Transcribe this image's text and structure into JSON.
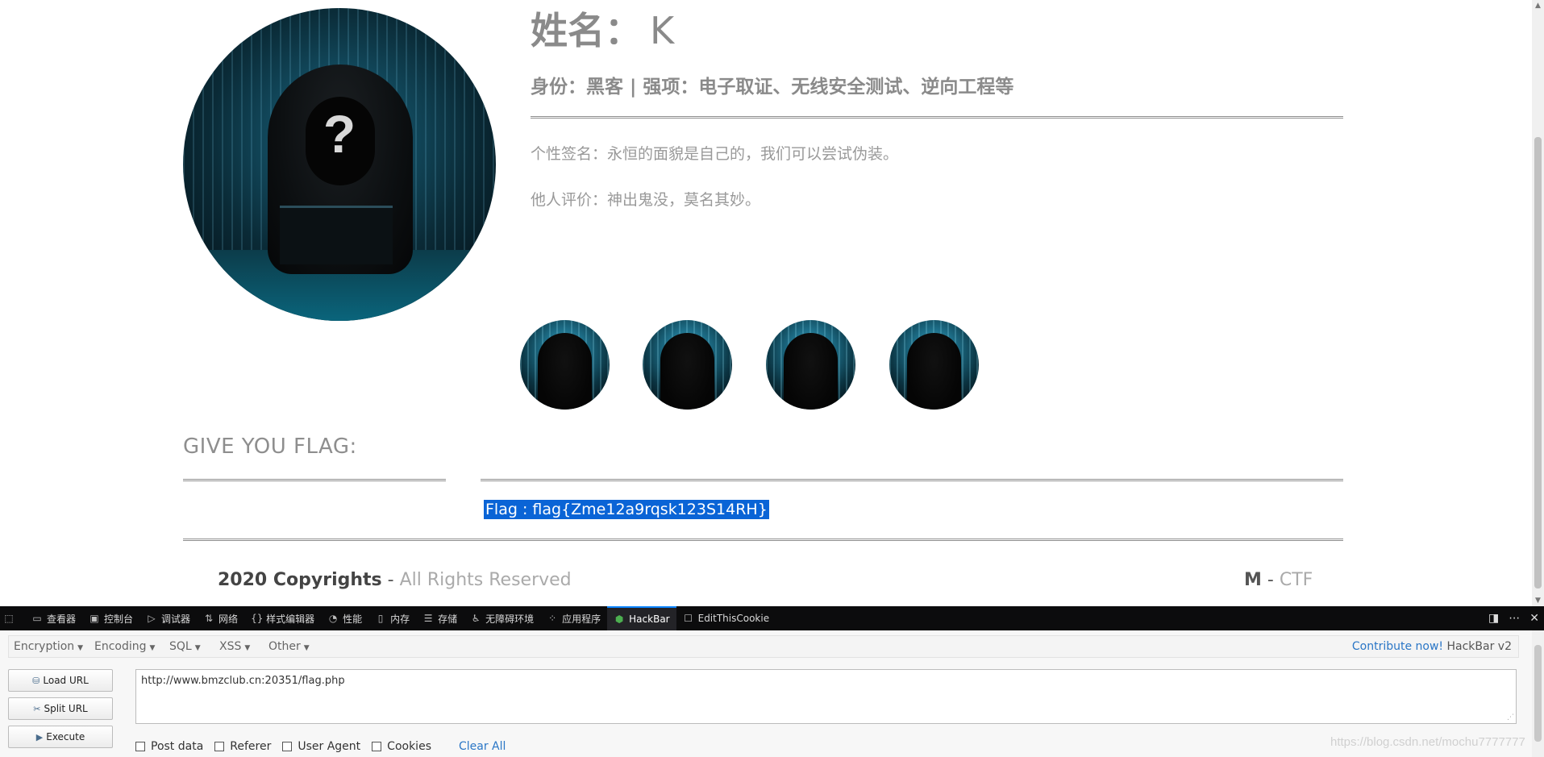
{
  "profile": {
    "name_label": "姓名：",
    "name_value": "K",
    "role": "身份：黑客 | 强项：电子取证、无线安全测试、逆向工程等",
    "signature": "个性签名：永恒的面貌是自己的，我们可以尝试伪装。",
    "evaluation": "他人评价：神出鬼没，莫名其妙。"
  },
  "flag_section": {
    "heading": "GIVE YOU FLAG:",
    "flag_text": "Flag : flag{Zme12a9rqsk123S14RH}"
  },
  "footer": {
    "left_bold": "2020 Copyrights",
    "left_sep": " - ",
    "left_muted": "All Rights Reserved",
    "right_bold": "M",
    "right_sep": " - ",
    "right_muted": "CTF"
  },
  "devtools": {
    "tabs": [
      {
        "label": "查看器",
        "icon": "inspector-icon"
      },
      {
        "label": "控制台",
        "icon": "console-icon"
      },
      {
        "label": "调试器",
        "icon": "debugger-icon"
      },
      {
        "label": "网络",
        "icon": "network-icon"
      },
      {
        "label": "样式编辑器",
        "icon": "style-editor-icon"
      },
      {
        "label": "性能",
        "icon": "performance-icon"
      },
      {
        "label": "内存",
        "icon": "memory-icon"
      },
      {
        "label": "存储",
        "icon": "storage-icon"
      },
      {
        "label": "无障碍环境",
        "icon": "accessibility-icon"
      },
      {
        "label": "应用程序",
        "icon": "application-icon"
      },
      {
        "label": "HackBar",
        "icon": "hackbar-icon"
      },
      {
        "label": "EditThisCookie",
        "icon": "cookie-icon"
      }
    ],
    "active_tab": "HackBar"
  },
  "hackbar": {
    "menu": [
      "Encryption",
      "Encoding",
      "SQL",
      "XSS",
      "Other"
    ],
    "contribute_link": "Contribute now!",
    "version": "HackBar v2",
    "buttons": {
      "load": "Load URL",
      "split": "Split URL",
      "execute": "Execute"
    },
    "url": "http://www.bmzclub.cn:20351/flag.php",
    "options": [
      "Post data",
      "Referer",
      "User Agent",
      "Cookies"
    ],
    "clear_all": "Clear All"
  },
  "watermark": "https://blog.csdn.net/mochu7777777",
  "colors": {
    "text_gray": "#8a8a8a",
    "selection_blue": "#0a64d6",
    "devtools_bg": "#0c0c0d",
    "link_blue": "#2a76c6"
  }
}
